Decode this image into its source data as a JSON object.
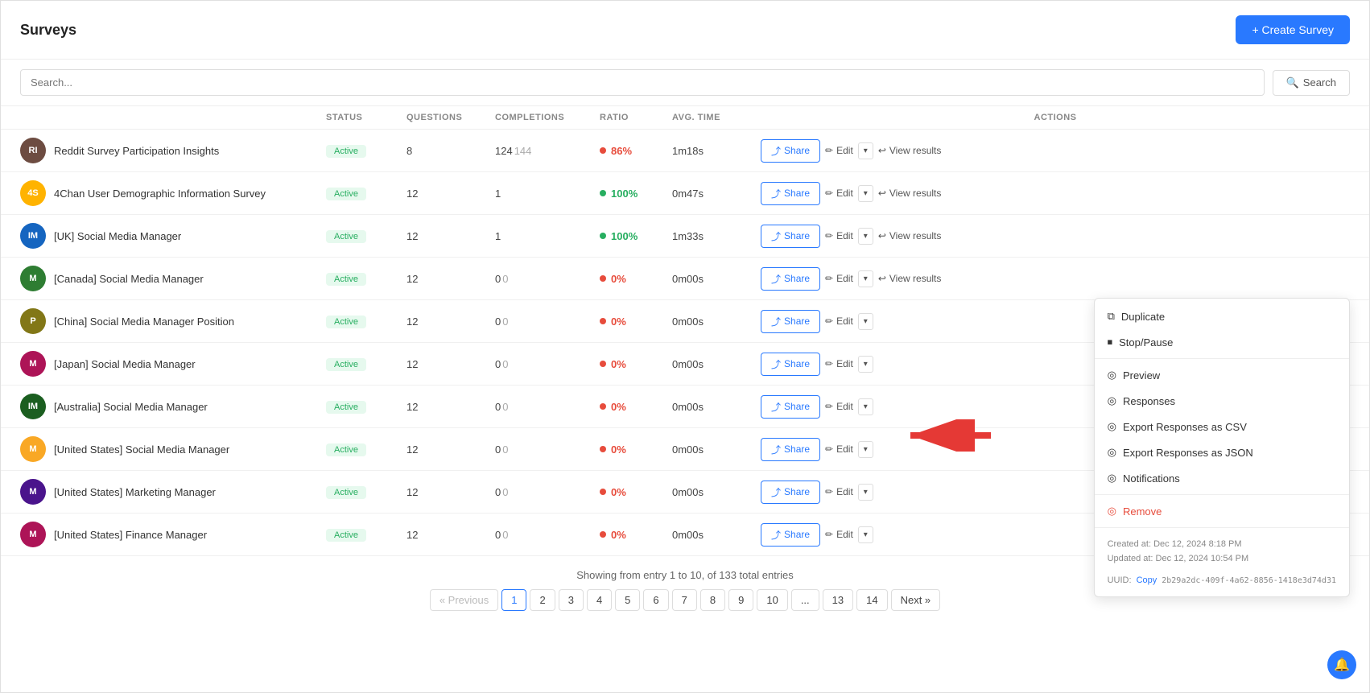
{
  "page": {
    "title": "Surveys",
    "create_button": "+ Create Survey"
  },
  "search": {
    "placeholder": "Search...",
    "button_label": "Search"
  },
  "table": {
    "columns": [
      "",
      "STATUS",
      "QUESTIONS",
      "COMPLETIONS",
      "RATIO",
      "AVG. TIME",
      "ACTIONS"
    ],
    "rows": [
      {
        "id": 1,
        "avatar_initials": "RI",
        "avatar_color": "#6d4c41",
        "name": "Reddit Survey Participation Insights",
        "status": "Active",
        "questions": 8,
        "completions_main": "124",
        "completions_total": "144",
        "ratio_dot_color": "#e74c3c",
        "ratio_pct": "86%",
        "ratio_color": "red",
        "avg_time": "1m18s",
        "show_view_results": true,
        "show_dropdown": false
      },
      {
        "id": 2,
        "avatar_initials": "4S",
        "avatar_color": "#ffb300",
        "name": "4Chan User Demographic Information Survey",
        "status": "Active",
        "questions": 12,
        "completions_main": "1",
        "completions_total": "1",
        "ratio_dot_color": "#27ae60",
        "ratio_pct": "100%",
        "ratio_color": "green",
        "avg_time": "0m47s",
        "show_view_results": true,
        "show_dropdown": false
      },
      {
        "id": 3,
        "avatar_initials": "IM",
        "avatar_color": "#1565c0",
        "name": "[UK] Social Media Manager",
        "status": "Active",
        "questions": 12,
        "completions_main": "1",
        "completions_total": "1",
        "ratio_dot_color": "#27ae60",
        "ratio_pct": "100%",
        "ratio_color": "green",
        "avg_time": "1m33s",
        "show_view_results": true,
        "show_dropdown": false
      },
      {
        "id": 4,
        "avatar_initials": "M",
        "avatar_color": "#2e7d32",
        "name": "[Canada] Social Media Manager",
        "status": "Active",
        "questions": 12,
        "completions_main": "0",
        "completions_total": "0",
        "ratio_dot_color": "#e74c3c",
        "ratio_pct": "0%",
        "ratio_color": "red",
        "avg_time": "0m00s",
        "show_view_results": true,
        "show_dropdown": true
      },
      {
        "id": 5,
        "avatar_initials": "P",
        "avatar_color": "#827717",
        "name": "[China] Social Media Manager Position",
        "status": "Active",
        "questions": 12,
        "completions_main": "0",
        "completions_total": "0",
        "ratio_dot_color": "#e74c3c",
        "ratio_pct": "0%",
        "ratio_color": "red",
        "avg_time": "0m00s",
        "show_view_results": false,
        "show_dropdown": false
      },
      {
        "id": 6,
        "avatar_initials": "M",
        "avatar_color": "#ad1457",
        "name": "[Japan] Social Media Manager",
        "status": "Active",
        "questions": 12,
        "completions_main": "0",
        "completions_total": "0",
        "ratio_dot_color": "#e74c3c",
        "ratio_pct": "0%",
        "ratio_color": "red",
        "avg_time": "0m00s",
        "show_view_results": false,
        "show_dropdown": false
      },
      {
        "id": 7,
        "avatar_initials": "IM",
        "avatar_color": "#1b5e20",
        "name": "[Australia] Social Media Manager",
        "status": "Active",
        "questions": 12,
        "completions_main": "0",
        "completions_total": "0",
        "ratio_dot_color": "#e74c3c",
        "ratio_pct": "0%",
        "ratio_color": "red",
        "avg_time": "0m00s",
        "show_view_results": false,
        "show_dropdown": false
      },
      {
        "id": 8,
        "avatar_initials": "M",
        "avatar_color": "#f9a825",
        "name": "[United States] Social Media Manager",
        "status": "Active",
        "questions": 12,
        "completions_main": "0",
        "completions_total": "0",
        "ratio_dot_color": "#e74c3c",
        "ratio_pct": "0%",
        "ratio_color": "red",
        "avg_time": "0m00s",
        "show_view_results": false,
        "show_dropdown": false
      },
      {
        "id": 9,
        "avatar_initials": "M",
        "avatar_color": "#4a148c",
        "name": "[United States] Marketing Manager",
        "status": "Active",
        "questions": 12,
        "completions_main": "0",
        "completions_total": "0",
        "ratio_dot_color": "#e74c3c",
        "ratio_pct": "0%",
        "ratio_color": "red",
        "avg_time": "0m00s",
        "show_view_results": false,
        "show_dropdown": false
      },
      {
        "id": 10,
        "avatar_initials": "M",
        "avatar_color": "#ad1457",
        "name": "[United States] Finance Manager",
        "status": "Active",
        "questions": 12,
        "completions_main": "0",
        "completions_total": "0",
        "ratio_dot_color": "#e74c3c",
        "ratio_pct": "0%",
        "ratio_color": "red",
        "avg_time": "0m00s",
        "show_view_results": false,
        "show_dropdown": false
      }
    ]
  },
  "dropdown_menu": {
    "items": [
      {
        "label": "Duplicate",
        "icon": "⧉",
        "color": "normal"
      },
      {
        "label": "Stop/Pause",
        "icon": "⏹",
        "color": "normal"
      },
      {
        "label": "Preview",
        "icon": "◎",
        "color": "normal"
      },
      {
        "label": "Responses",
        "icon": "◎",
        "color": "normal"
      },
      {
        "label": "Export Responses as CSV",
        "icon": "◎",
        "color": "normal"
      },
      {
        "label": "Export Responses as JSON",
        "icon": "◎",
        "color": "normal"
      },
      {
        "label": "Notifications",
        "icon": "◎",
        "color": "normal"
      },
      {
        "label": "Remove",
        "icon": "◎",
        "color": "red"
      }
    ],
    "meta_created": "Created at: Dec 12, 2024 8:18 PM",
    "meta_updated": "Updated at: Dec 12, 2024 10:54 PM",
    "uuid_label": "UUID:",
    "uuid_value": "2b29a2dc-409f-4a62-8856-1418e3d74d31",
    "copy_label": "Copy"
  },
  "pagination": {
    "showing_text": "Showing from entry 1 to 10, of 133 total entries",
    "prev_label": "« Previous",
    "next_label": "Next »",
    "pages": [
      "1",
      "2",
      "3",
      "4",
      "5",
      "6",
      "7",
      "8",
      "9",
      "10",
      "...",
      "13",
      "14"
    ],
    "active_page": "1"
  },
  "labels": {
    "share": "Share",
    "edit": "Edit",
    "view_results": "View results"
  }
}
